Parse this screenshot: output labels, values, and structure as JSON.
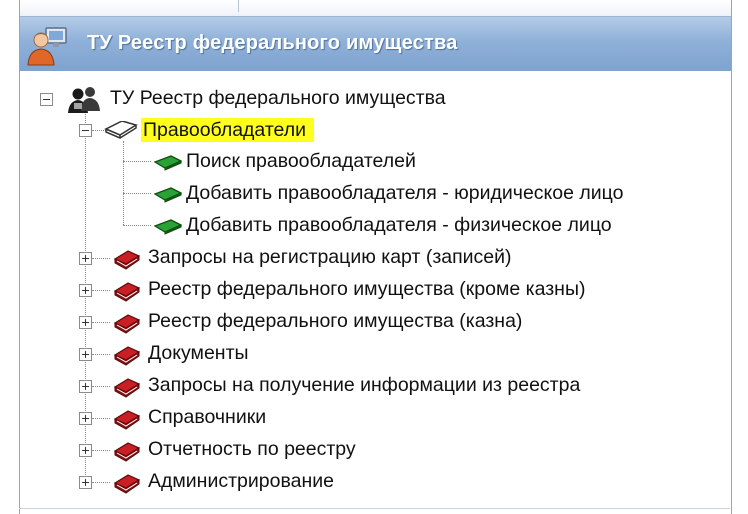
{
  "window": {
    "title": "ТУ Реестр федерального имущества"
  },
  "tree": {
    "root": {
      "label": "ТУ Реестр федерального имущества",
      "expanded": true
    },
    "rightholders": {
      "label": "Правообладатели",
      "highlighted": true,
      "highlight_color": "#ffff1e",
      "expanded": true,
      "children": [
        {
          "label": "Поиск правообладателей"
        },
        {
          "label": "Добавить правообладателя - юридическое лицо"
        },
        {
          "label": "Добавить правообладателя - физическое лицо"
        }
      ]
    },
    "groups": [
      {
        "label": "Запросы на регистрацию карт (записей)",
        "expanded": false
      },
      {
        "label": "Реестр федерального имущества (кроме казны)",
        "expanded": false
      },
      {
        "label": "Реестр федерального имущества (казна)",
        "expanded": false
      },
      {
        "label": "Документы",
        "expanded": false
      },
      {
        "label": "Запросы на получение информации из реестра",
        "expanded": false
      },
      {
        "label": "Справочники",
        "expanded": false
      },
      {
        "label": "Отчетность по реестру",
        "expanded": false
      },
      {
        "label": "Администрирование",
        "expanded": false
      }
    ]
  },
  "icons": {
    "header": "users-computer-icon",
    "root": "users-group-icon",
    "folder_open": "open-book-icon",
    "leaf": "green-arrow-icon",
    "group": "red-book-icon"
  },
  "colors": {
    "header_gradient_top": "#b4cbe7",
    "header_gradient_bottom": "#7ea3cf",
    "book_red": "#b3161b",
    "leaf_green": "#1f8a2a"
  }
}
